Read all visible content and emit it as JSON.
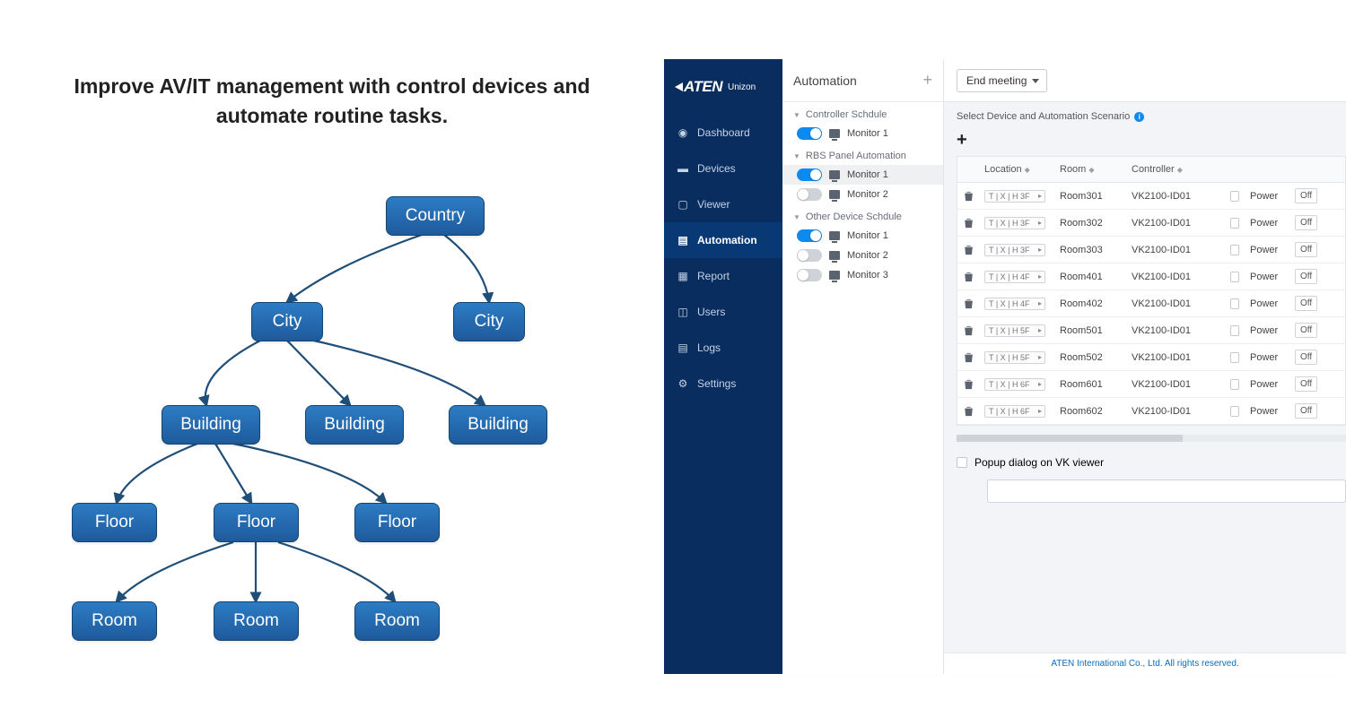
{
  "headline": "Improve AV/IT management with control devices and automate routine tasks.",
  "hierarchy": {
    "l0": "Country",
    "l1": "City",
    "l2": "Building",
    "l3": "Floor",
    "l4": "Room"
  },
  "brand": {
    "name": "ATEN",
    "product": "Unizon"
  },
  "nav": [
    {
      "label": "Dashboard",
      "active": false
    },
    {
      "label": "Devices",
      "active": false
    },
    {
      "label": "Viewer",
      "active": false
    },
    {
      "label": "Automation",
      "active": true
    },
    {
      "label": "Report",
      "active": false
    },
    {
      "label": "Users",
      "active": false
    },
    {
      "label": "Logs",
      "active": false
    },
    {
      "label": "Settings",
      "active": false
    }
  ],
  "mid": {
    "title": "Automation",
    "sections": [
      {
        "title": "Controller Schdule",
        "items": [
          {
            "label": "Monitor 1",
            "on": true,
            "sel": false
          }
        ]
      },
      {
        "title": "RBS Panel Automation",
        "items": [
          {
            "label": "Monitor 1",
            "on": true,
            "sel": true
          },
          {
            "label": "Monitor 2",
            "on": false,
            "sel": false
          }
        ]
      },
      {
        "title": "Other Device Schdule",
        "items": [
          {
            "label": "Monitor 1",
            "on": true,
            "sel": false
          },
          {
            "label": "Monitor 2",
            "on": false,
            "sel": false
          },
          {
            "label": "Monitor 3",
            "on": false,
            "sel": false
          }
        ]
      }
    ]
  },
  "dropdown": "End meeting",
  "panel_label": "Select Device and Automation Scenario",
  "columns": {
    "location": "Location",
    "room": "Room",
    "controller": "Controller",
    "power": "Power",
    "off": "Off"
  },
  "rows": [
    {
      "loc": "T | X | H  3F",
      "room": "Room301",
      "controller": "VK2100-ID01",
      "power": "Power",
      "off": "Off"
    },
    {
      "loc": "T | X | H  3F",
      "room": "Room302",
      "controller": "VK2100-ID01",
      "power": "Power",
      "off": "Off"
    },
    {
      "loc": "T | X | H  3F",
      "room": "Room303",
      "controller": "VK2100-ID01",
      "power": "Power",
      "off": "Off"
    },
    {
      "loc": "T | X | H  4F",
      "room": "Room401",
      "controller": "VK2100-ID01",
      "power": "Power",
      "off": "Off"
    },
    {
      "loc": "T | X | H  4F",
      "room": "Room402",
      "controller": "VK2100-ID01",
      "power": "Power",
      "off": "Off"
    },
    {
      "loc": "T | X | H  5F",
      "room": "Room501",
      "controller": "VK2100-ID01",
      "power": "Power",
      "off": "Off"
    },
    {
      "loc": "T | X | H  5F",
      "room": "Room502",
      "controller": "VK2100-ID01",
      "power": "Power",
      "off": "Off"
    },
    {
      "loc": "T | X | H  6F",
      "room": "Room601",
      "controller": "VK2100-ID01",
      "power": "Power",
      "off": "Off"
    },
    {
      "loc": "T | X | H  6F",
      "room": "Room602",
      "controller": "VK2100-ID01",
      "power": "Power",
      "off": "Off"
    }
  ],
  "popup_label": "Popup dialog on VK viewer",
  "footer": "ATEN International Co., Ltd. All rights reserved."
}
